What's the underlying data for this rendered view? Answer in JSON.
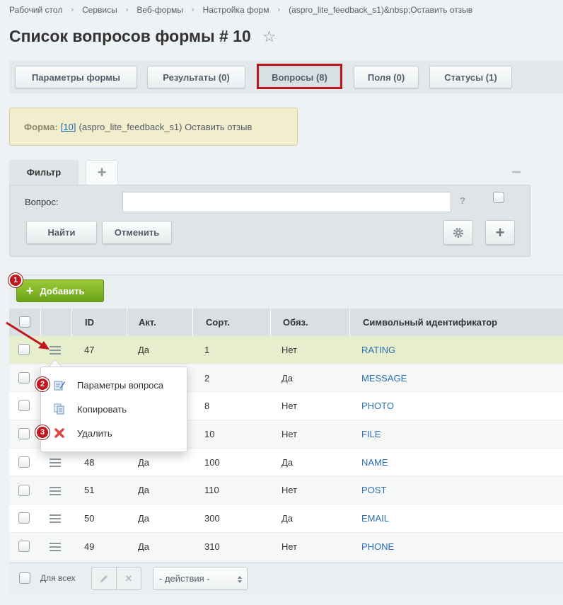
{
  "breadcrumbs": [
    "Рабочий стол",
    "Сервисы",
    "Веб-формы",
    "Настройка форм",
    "(aspro_lite_feedback_s1)&nbsp;Оставить отзыв"
  ],
  "page_title": "Список вопросов формы # 10",
  "tabs": [
    {
      "label": "Параметры формы"
    },
    {
      "label": "Результаты (0)"
    },
    {
      "label": "Вопросы (8)"
    },
    {
      "label": "Поля (0)"
    },
    {
      "label": "Статусы (1)"
    }
  ],
  "info": {
    "label": "Форма:",
    "link": "[10]",
    "text": "(aspro_lite_feedback_s1) Оставить отзыв"
  },
  "filter": {
    "tab_label": "Фильтр",
    "add_tab": "+",
    "collapse": "−",
    "field_label": "Вопрос:",
    "field_value": "",
    "help": "?",
    "find_button": "Найти",
    "cancel_button": "Отменить"
  },
  "toolbar": {
    "add_button": "Добавить"
  },
  "annotations": [
    "1",
    "2",
    "3"
  ],
  "columns": [
    "ID",
    "Акт.",
    "Сорт.",
    "Обяз.",
    "Символьный идентификатор"
  ],
  "rows": [
    {
      "id": "47",
      "active": "Да",
      "sort": "1",
      "required": "Нет",
      "code": "RATING"
    },
    {
      "id": "",
      "active": "",
      "sort": "2",
      "required": "Да",
      "code": "MESSAGE"
    },
    {
      "id": "",
      "active": "",
      "sort": "8",
      "required": "Нет",
      "code": "PHOTO"
    },
    {
      "id": "",
      "active": "",
      "sort": "10",
      "required": "Нет",
      "code": "FILE"
    },
    {
      "id": "48",
      "active": "Да",
      "sort": "100",
      "required": "Да",
      "code": "NAME"
    },
    {
      "id": "51",
      "active": "Да",
      "sort": "110",
      "required": "Нет",
      "code": "POST"
    },
    {
      "id": "50",
      "active": "Да",
      "sort": "300",
      "required": "Да",
      "code": "EMAIL"
    },
    {
      "id": "49",
      "active": "Да",
      "sort": "310",
      "required": "Нет",
      "code": "PHONE"
    }
  ],
  "context_menu": [
    "Параметры вопроса",
    "Копировать",
    "Удалить"
  ],
  "footer": {
    "for_all": "Для всех",
    "actions": "- действия -"
  },
  "colors": {
    "accent_green": "#7db627",
    "highlight_red": "#c0161b",
    "link_blue": "#2d6eb3"
  }
}
